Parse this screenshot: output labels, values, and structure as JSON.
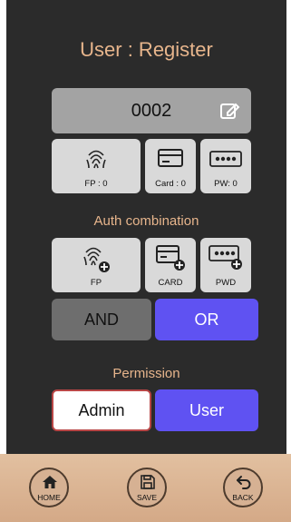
{
  "header": {
    "title": "User : Register"
  },
  "user": {
    "id": "0002"
  },
  "counts": {
    "fp": "FP : 0",
    "card": "Card : 0",
    "pw": "PW: 0"
  },
  "auth": {
    "label": "Auth combination",
    "fp": "FP",
    "card": "CARD",
    "pwd": "PWD",
    "and": "AND",
    "or": "OR",
    "selected_logic": "OR"
  },
  "permission": {
    "label": "Permission",
    "admin": "Admin",
    "user": "User",
    "selected": "User"
  },
  "nav": {
    "home": "HOME",
    "save": "SAVE",
    "back": "BACK"
  },
  "colors": {
    "accent": "#e7b58c",
    "selected": "#5f52f2",
    "panel": "#2b2b2b",
    "tile": "#d9d9d9"
  },
  "icons": [
    "edit-icon",
    "fingerprint-icon",
    "card-icon",
    "password-icon",
    "add-badge-icon",
    "home-icon",
    "save-icon",
    "back-icon"
  ]
}
